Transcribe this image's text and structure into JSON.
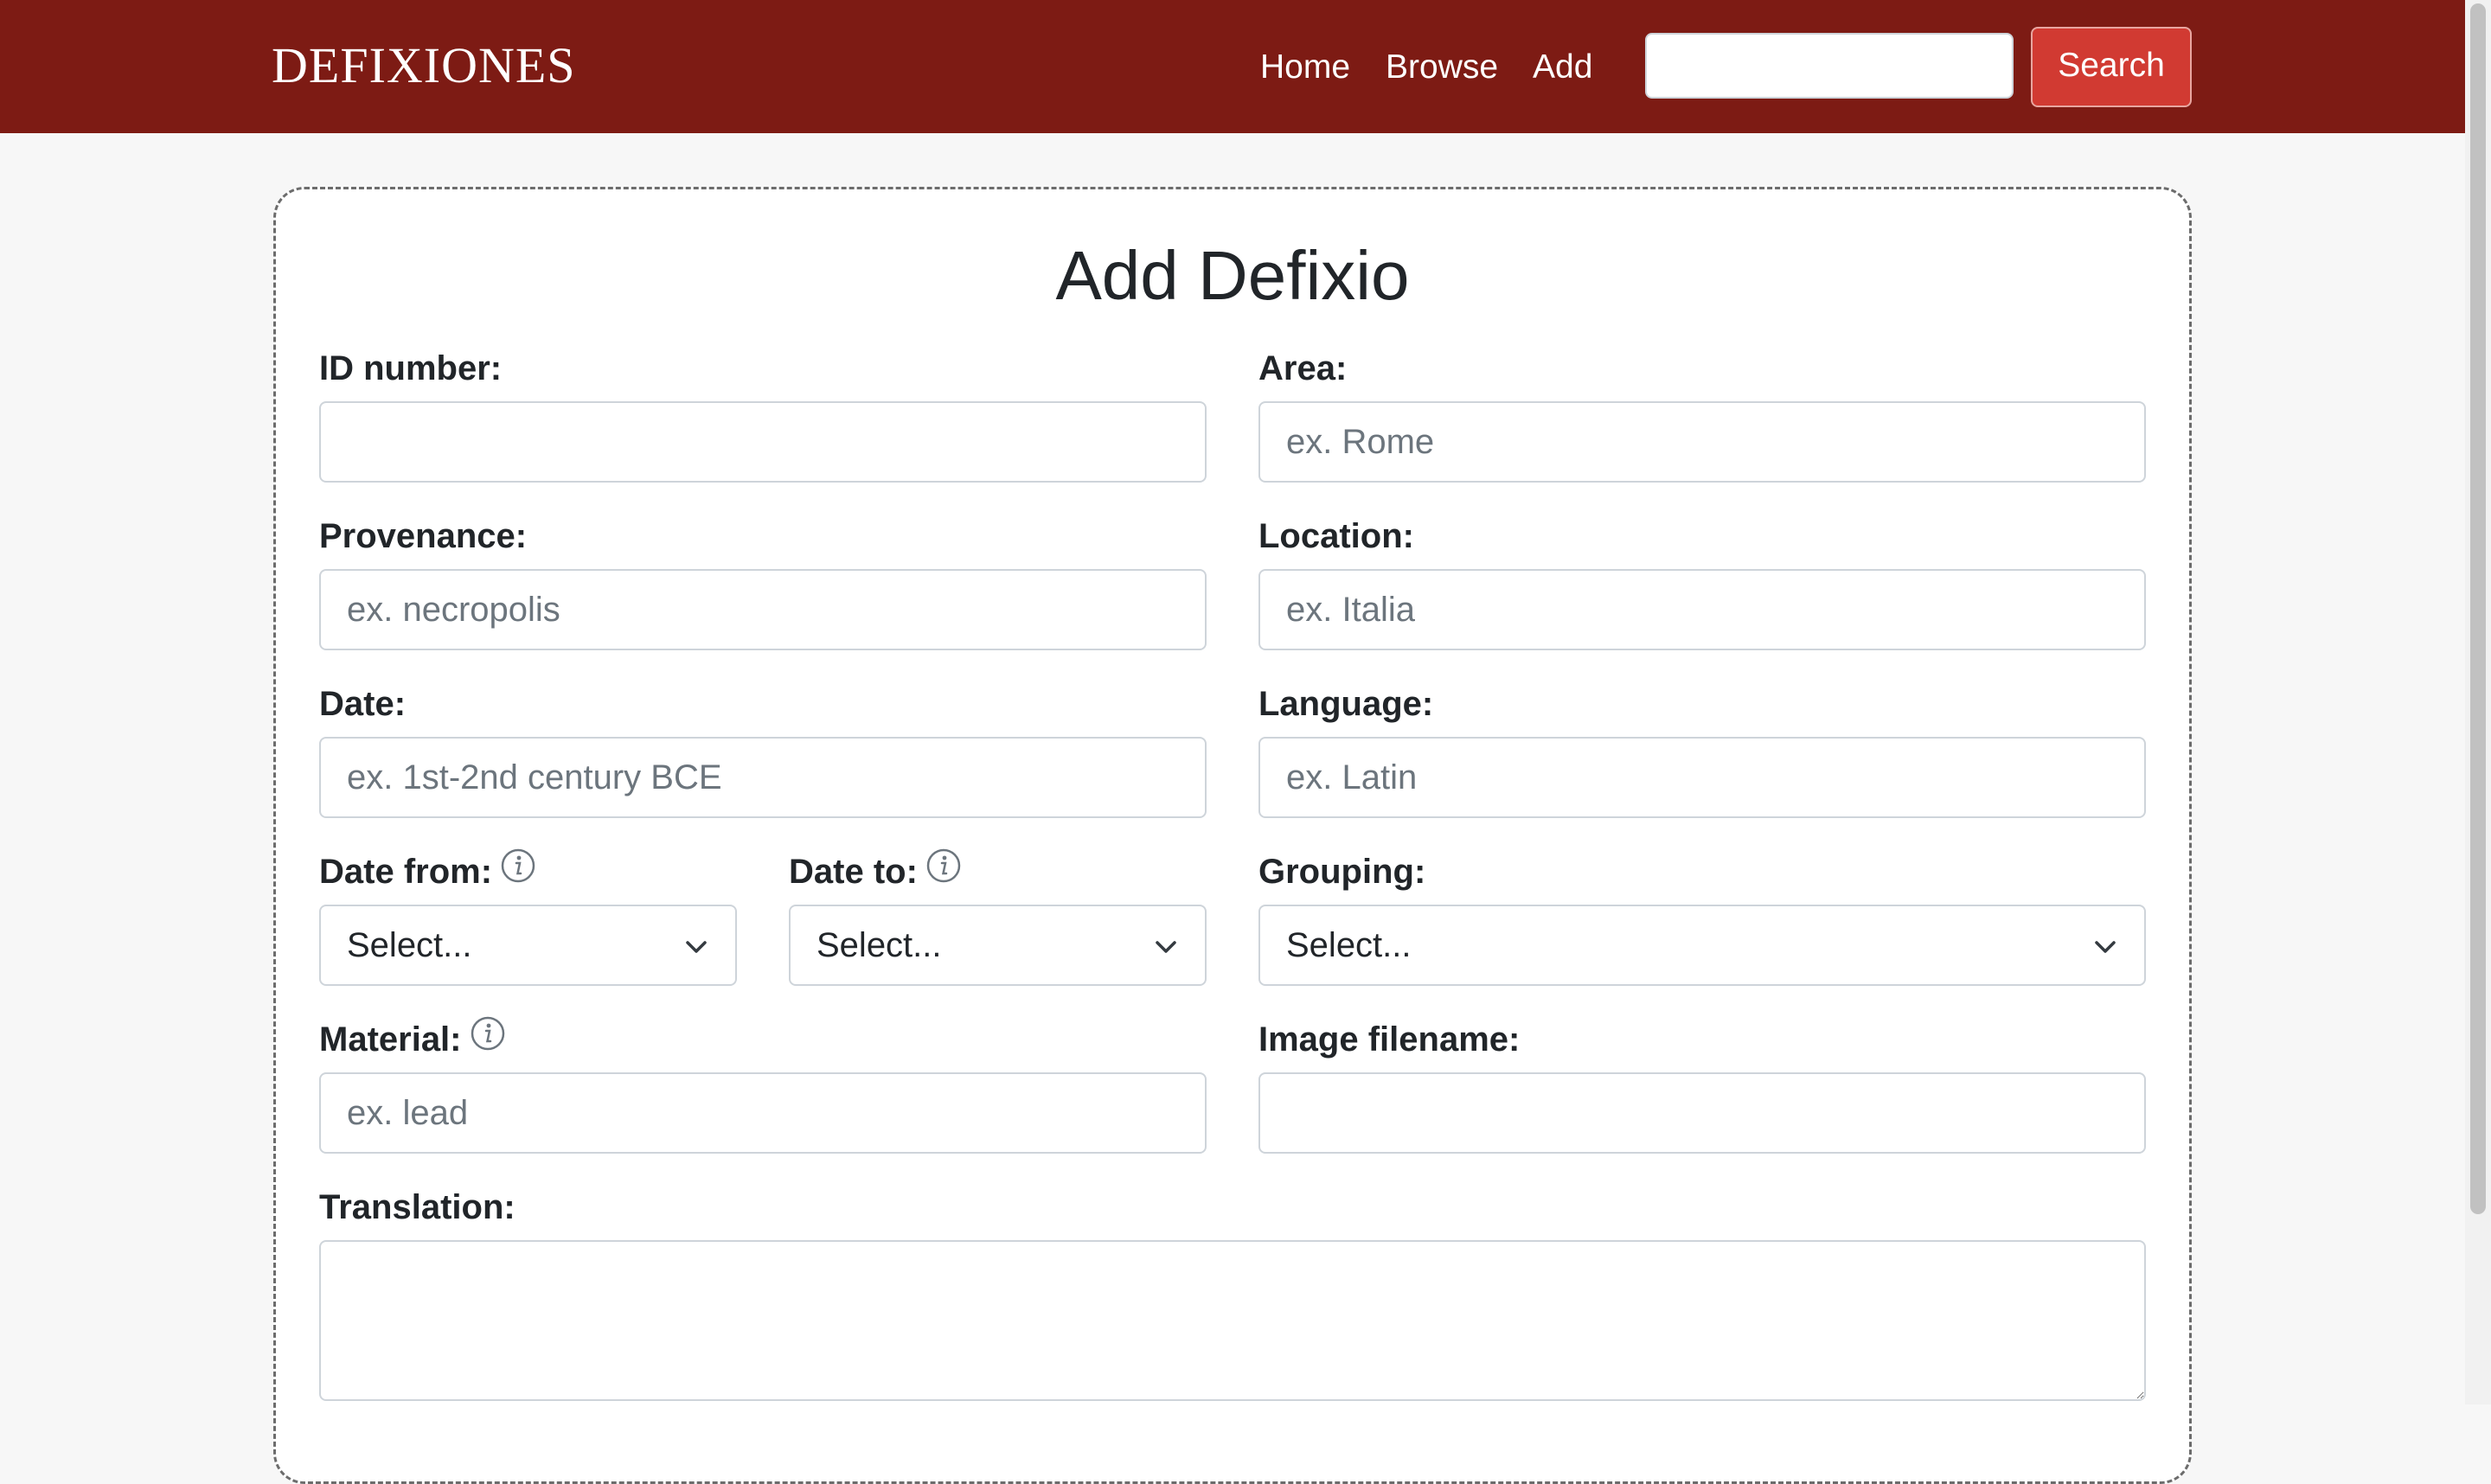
{
  "navbar": {
    "brand": "DEFIXIONES",
    "links": [
      "Home",
      "Browse",
      "Add"
    ],
    "search": {
      "value": "",
      "placeholder": ""
    },
    "search_button": "Search"
  },
  "form": {
    "title": "Add Defixio",
    "fields": {
      "id_number": {
        "label": "ID number:",
        "placeholder": ""
      },
      "area": {
        "label": "Area:",
        "placeholder": "ex. Rome"
      },
      "provenance": {
        "label": "Provenance:",
        "placeholder": "ex. necropolis"
      },
      "location": {
        "label": "Location:",
        "placeholder": "ex. Italia"
      },
      "date": {
        "label": "Date:",
        "placeholder": "ex. 1st-2nd century BCE"
      },
      "language": {
        "label": "Language:",
        "placeholder": "ex. Latin"
      },
      "date_from": {
        "label": "Date from:",
        "selected": "Select..."
      },
      "date_to": {
        "label": "Date to:",
        "selected": "Select..."
      },
      "grouping": {
        "label": "Grouping:",
        "selected": "Select..."
      },
      "material": {
        "label": "Material:",
        "placeholder": "ex. lead"
      },
      "image_filename": {
        "label": "Image filename:",
        "placeholder": ""
      },
      "translation": {
        "label": "Translation:",
        "placeholder": ""
      }
    }
  },
  "icons": {
    "info": "info-circle-icon",
    "chevron": "chevron-down-icon"
  },
  "colors": {
    "navbar_bg": "#7d1b14",
    "search_button_bg": "#d13a32",
    "page_bg": "#f7f7f7"
  }
}
